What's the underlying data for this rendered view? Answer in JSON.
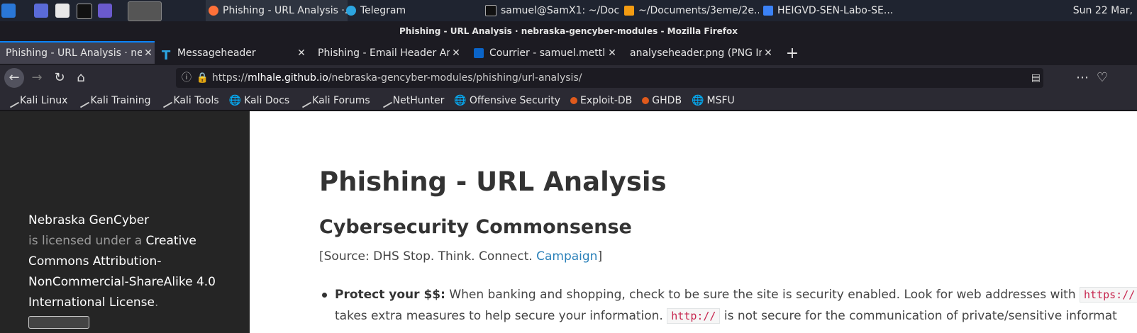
{
  "taskbar": {
    "windows": [
      {
        "label": "Phishing - URL Analysis ·...",
        "active": true
      },
      {
        "label": "Telegram"
      },
      {
        "label": "samuel@SamX1: ~/Doc..."
      },
      {
        "label": "~/Documents/3eme/2e..."
      },
      {
        "label": "HEIGVD-SEN-Labo-SE..."
      }
    ],
    "clock": "Sun 22 Mar,"
  },
  "window_title": "Phishing - URL Analysis · nebraska-gencyber-modules - Mozilla Firefox",
  "tabs": [
    {
      "label": "Phishing - URL Analysis · neb",
      "active": true
    },
    {
      "label": "Messageheader"
    },
    {
      "label": "Phishing - Email Header Ana"
    },
    {
      "label": "Courrier - samuel.mettle"
    },
    {
      "label": "analyseheader.png (PNG Ima"
    }
  ],
  "new_tab": "+",
  "url": {
    "scheme": "https://",
    "host": "mlhale.github.io",
    "path": "/nebraska-gencyber-modules/phishing/url-analysis/"
  },
  "bookmarks": [
    "Kali Linux",
    "Kali Training",
    "Kali Tools",
    "Kali Docs",
    "Kali Forums",
    "NetHunter",
    "Offensive Security",
    "Exploit-DB",
    "GHDB",
    "MSFU"
  ],
  "sidebar": {
    "org": "Nebraska GenCyber",
    "licensed_text": "is licensed under a",
    "license_link": "Creative Commons Attribution-NonCommercial-ShareAlike 4.0 International License",
    "period": "."
  },
  "content": {
    "title": "Phishing - URL Analysis",
    "subtitle": "Cybersecurity Commonsense",
    "source_prefix": "[Source: DHS Stop. Think. Connect.",
    "source_link": "Campaign",
    "source_suffix": "]",
    "bullet_label": "Protect your $$:",
    "bullet_text_1": "When banking and shopping, check to be sure the site is security enabled. Look for web addresses with",
    "code_https": "https://",
    "bullet_text_2": "takes extra measures to help secure your information.",
    "code_http": "http://",
    "bullet_text_3": "is not secure for the communication of private/sensitive informat"
  },
  "colors": {
    "link": "#2980b9",
    "sidebar_bg": "#252525",
    "tab_accent": "#0a84ff"
  }
}
